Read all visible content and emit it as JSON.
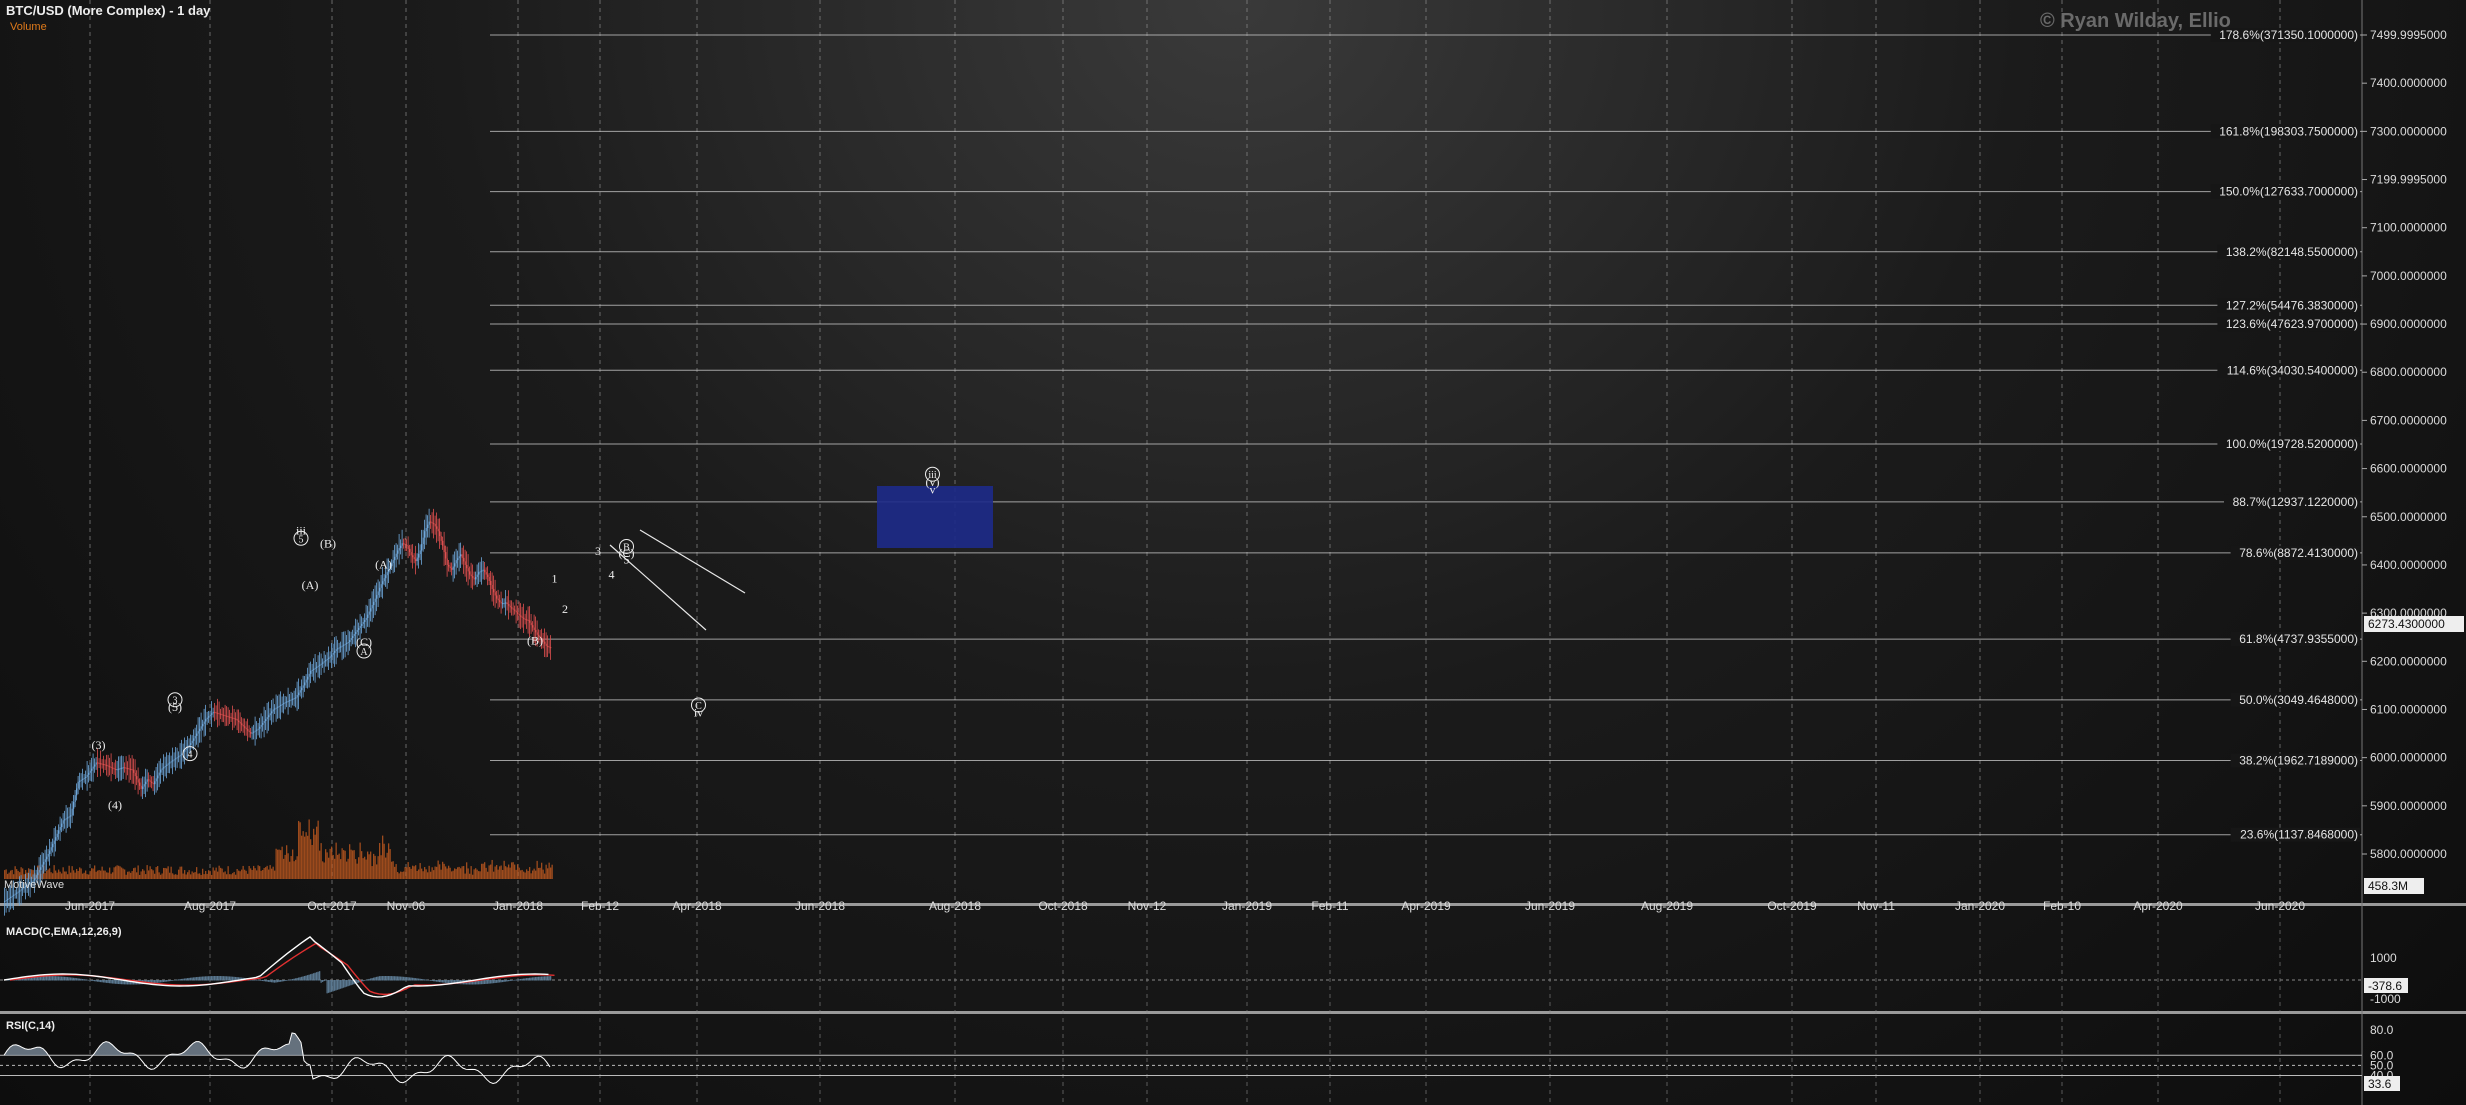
{
  "header": {
    "title": "BTC/USD (More Complex) - 1 day",
    "subtitle": "Volume",
    "watermark": "© Ryan Wilday, Ellio",
    "motivewave": "MotiveWave"
  },
  "colors": {
    "background": "#121212",
    "up": "#6fa8dc",
    "down": "#e05050",
    "volume": "#b5551f",
    "grid": "#8a8a8a",
    "box": "#1d2a8a",
    "macd_line": "#ffffff",
    "macd_signal": "#e03030",
    "histogram": "#5a7890",
    "rsi": "#ffffff",
    "rsi_fill": "#7a8a99"
  },
  "chart_data": [
    {
      "type": "line",
      "title": "BTC/USD (More Complex) - 1 day",
      "price_axis_labels": [
        "7499.9995000",
        "7400.0000000",
        "7300.0000000",
        "7199.9995000",
        "7100.0000000",
        "7000.0000000",
        "6900.0000000",
        "6800.0000000",
        "6700.0000000",
        "6600.0000000",
        "6500.0000000",
        "6400.0000000",
        "6300.0000000",
        "6200.0000000",
        "6100.0000000",
        "6000.0000000",
        "5900.0000000",
        "5800.0000000"
      ],
      "x_tick_labels": [
        "Jun-2017",
        "Aug-2017",
        "Oct-2017",
        "Nov-06",
        "Jan-2018",
        "Feb-12",
        "Apr-2018",
        "Jun-2018",
        "Aug-2018",
        "Oct-2018",
        "Nov-12",
        "Jan-2019",
        "Feb-11",
        "Apr-2019",
        "Jun-2019",
        "Aug-2019",
        "Oct-2019",
        "Nov-11",
        "Jan-2020",
        "Feb-10",
        "Apr-2020",
        "Jun-2020"
      ],
      "current_price": "6273.4300000",
      "volume_value": "458.3M",
      "fib_levels": [
        {
          "label": "178.6%(371350.1000000)",
          "price": 7499.9995
        },
        {
          "label": "161.8%(198303.7500000)",
          "price": 7300
        },
        {
          "label": "150.0%(127633.7000000)",
          "price": 7175
        },
        {
          "label": "138.2%(82148.5500000)",
          "price": 7050
        },
        {
          "label": "127.2%(54476.3830000)",
          "price": 6939
        },
        {
          "label": "123.6%(47623.9700000)",
          "price": 6900
        },
        {
          "label": "114.6%(34030.5400000)",
          "price": 6804
        },
        {
          "label": "100.0%(19728.5200000)",
          "price": 6651
        },
        {
          "label": "88.7%(12937.1220000)",
          "price": 6531
        },
        {
          "label": "78.6%(8872.4130000)",
          "price": 6425
        },
        {
          "label": "61.8%(4737.9355000)",
          "price": 6246
        },
        {
          "label": "50.0%(3049.4648000)",
          "price": 6120
        },
        {
          "label": "38.2%(1962.7189000)",
          "price": 5994
        },
        {
          "label": "23.6%(1137.8468000)",
          "price": 5840
        }
      ],
      "price_path": [
        [
          0,
          5700
        ],
        [
          10,
          5722
        ],
        [
          20,
          5745
        ],
        [
          30,
          5800
        ],
        [
          40,
          5870
        ],
        [
          45,
          5880
        ],
        [
          50,
          5950
        ],
        [
          55,
          5960
        ],
        [
          62,
          5990
        ],
        [
          68,
          5985
        ],
        [
          75,
          5975
        ],
        [
          80,
          5980
        ],
        [
          86,
          5975
        ],
        [
          92,
          5935
        ],
        [
          96,
          5955
        ],
        [
          100,
          5945
        ],
        [
          105,
          5975
        ],
        [
          110,
          5988
        ],
        [
          118,
          6005
        ],
        [
          125,
          6030
        ],
        [
          135,
          6080
        ],
        [
          140,
          6095
        ],
        [
          150,
          6085
        ],
        [
          155,
          6080
        ],
        [
          160,
          6065
        ],
        [
          165,
          6050
        ],
        [
          170,
          6060
        ],
        [
          175,
          6080
        ],
        [
          180,
          6100
        ],
        [
          188,
          6115
        ],
        [
          195,
          6125
        ],
        [
          200,
          6150
        ],
        [
          205,
          6180
        ],
        [
          212,
          6195
        ],
        [
          218,
          6210
        ],
        [
          222,
          6225
        ],
        [
          230,
          6240
        ],
        [
          236,
          6265
        ],
        [
          242,
          6290
        ],
        [
          248,
          6330
        ],
        [
          252,
          6360
        ],
        [
          256,
          6385
        ],
        [
          260,
          6410
        ],
        [
          263,
          6430
        ],
        [
          266,
          6445
        ],
        [
          269,
          6440
        ],
        [
          272,
          6420
        ],
        [
          275,
          6408
        ],
        [
          278,
          6430
        ],
        [
          281,
          6470
        ],
        [
          284,
          6490
        ],
        [
          287,
          6485
        ],
        [
          290,
          6470
        ],
        [
          293,
          6440
        ],
        [
          296,
          6400
        ],
        [
          299,
          6390
        ],
        [
          302,
          6410
        ],
        [
          305,
          6422
        ],
        [
          308,
          6400
        ],
        [
          311,
          6380
        ],
        [
          314,
          6370
        ],
        [
          317,
          6385
        ],
        [
          320,
          6390
        ],
        [
          323,
          6375
        ],
        [
          326,
          6350
        ],
        [
          329,
          6330
        ],
        [
          332,
          6320
        ],
        [
          335,
          6322
        ],
        [
          338,
          6312
        ],
        [
          341,
          6305
        ],
        [
          344,
          6295
        ],
        [
          347,
          6288
        ],
        [
          350,
          6285
        ],
        [
          353,
          6270
        ],
        [
          356,
          6255
        ],
        [
          359,
          6245
        ],
        [
          362,
          6232
        ],
        [
          365,
          6228
        ]
      ],
      "wave_labels": [
        {
          "text": "(3)",
          "day": 63,
          "price": 6018
        },
        {
          "text": "(4)",
          "day": 74,
          "price": 5893
        },
        {
          "text": "3",
          "day": 114,
          "price": 6112,
          "circled": true
        },
        {
          "text": "(5)",
          "day": 114,
          "price": 6097
        },
        {
          "text": "4",
          "day": 124,
          "price": 6000,
          "circled": true
        },
        {
          "text": "iii",
          "day": 198,
          "price": 6463
        },
        {
          "text": "5",
          "day": 198,
          "price": 6447,
          "circled": true
        },
        {
          "text": "(B)",
          "day": 216,
          "price": 6436
        },
        {
          "text": "(A)",
          "day": 204,
          "price": 6350
        },
        {
          "text": "(A)",
          "day": 253,
          "price": 6393
        },
        {
          "text": "(C)",
          "day": 240,
          "price": 6232
        },
        {
          "text": "A",
          "day": 240,
          "price": 6213,
          "circled": true
        },
        {
          "text": "(B)",
          "day": 354,
          "price": 6235
        },
        {
          "text": "B",
          "day": 415,
          "price": 6430,
          "circled": true
        },
        {
          "text": "(C)",
          "day": 415,
          "price": 6416
        },
        {
          "text": "5",
          "day": 415,
          "price": 6403
        },
        {
          "text": "1",
          "day": 367,
          "price": 6364
        },
        {
          "text": "3",
          "day": 396,
          "price": 6421
        },
        {
          "text": "4",
          "day": 405,
          "price": 6372
        },
        {
          "text": "2",
          "day": 374,
          "price": 6300
        },
        {
          "text": "C",
          "day": 463,
          "price": 6101,
          "circled": true
        },
        {
          "text": "iv",
          "day": 463,
          "price": 6085
        },
        {
          "text": "iii",
          "day": 619,
          "price": 6580,
          "circled": true
        },
        {
          "text": "(v)",
          "day": 619,
          "price": 6564
        },
        {
          "text": "v",
          "day": 619,
          "price": 6548
        }
      ],
      "box_labels": [
        "1",
        "3",
        "4",
        "2"
      ]
    },
    {
      "type": "line",
      "title": "MACD(C,EMA,12,26,9)",
      "axis_labels": [
        "1000",
        "-1000"
      ],
      "current_value": "-378.6"
    },
    {
      "type": "line",
      "title": "RSI(C,14)",
      "axis_labels": [
        "80.0",
        "60.0",
        "50.0",
        "40.0"
      ],
      "current_value": "33.6",
      "levels": [
        60,
        50,
        40
      ]
    }
  ]
}
